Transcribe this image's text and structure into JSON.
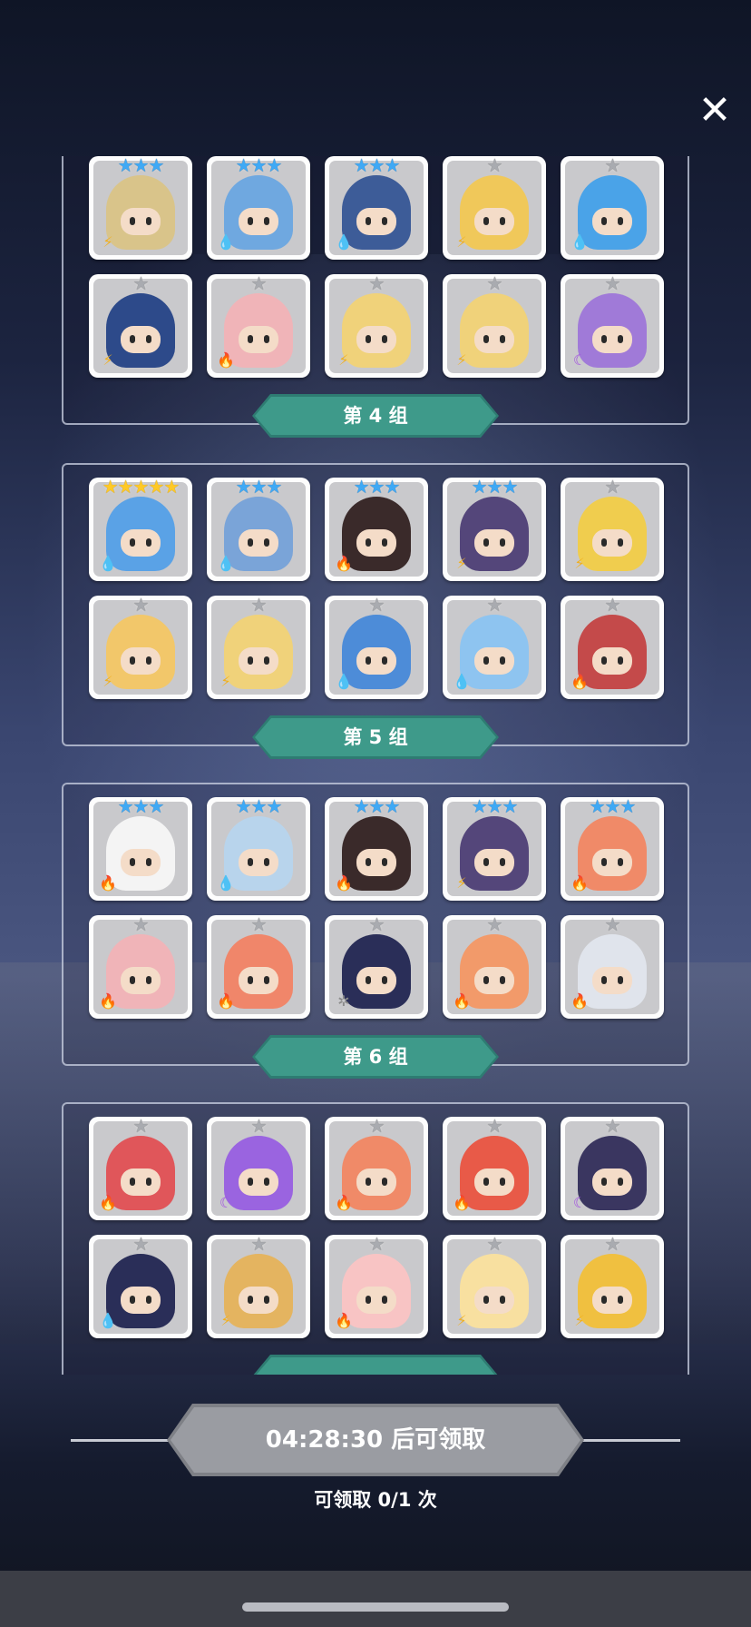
{
  "close_icon": "close-icon",
  "groups": [
    {
      "label": "第 4 组",
      "cards": [
        {
          "stars": 3,
          "star_color": "blue",
          "element": "thunder",
          "color": "#d9c48a"
        },
        {
          "stars": 3,
          "star_color": "blue",
          "element": "water",
          "color": "#6fa8e0"
        },
        {
          "stars": 3,
          "star_color": "blue",
          "element": "water",
          "color": "#3d5c98"
        },
        {
          "stars": 1,
          "star_color": "grey",
          "element": "thunder",
          "color": "#f0c85a"
        },
        {
          "stars": 1,
          "star_color": "grey",
          "element": "water",
          "color": "#4aa3e8"
        },
        {
          "stars": 1,
          "star_color": "grey",
          "element": "thunder",
          "color": "#2d4a8a"
        },
        {
          "stars": 1,
          "star_color": "grey",
          "element": "fire",
          "color": "#f0b4b8"
        },
        {
          "stars": 1,
          "star_color": "grey",
          "element": "thunder",
          "color": "#f0d27a"
        },
        {
          "stars": 1,
          "star_color": "grey",
          "element": "thunder",
          "color": "#f0d27a"
        },
        {
          "stars": 1,
          "star_color": "grey",
          "element": "dark",
          "color": "#a07ad8"
        }
      ]
    },
    {
      "label": "第 5 组",
      "cards": [
        {
          "stars": 5,
          "star_color": "gold",
          "element": "water",
          "color": "#5aa2e6"
        },
        {
          "stars": 3,
          "star_color": "blue",
          "element": "water",
          "color": "#7aa4d8"
        },
        {
          "stars": 3,
          "star_color": "blue",
          "element": "fire",
          "color": "#3a2a2a"
        },
        {
          "stars": 3,
          "star_color": "blue",
          "element": "thunder",
          "color": "#54467a"
        },
        {
          "stars": 1,
          "star_color": "grey",
          "element": "thunder",
          "color": "#f0cd4e"
        },
        {
          "stars": 1,
          "star_color": "grey",
          "element": "thunder",
          "color": "#f2c76a"
        },
        {
          "stars": 1,
          "star_color": "grey",
          "element": "thunder",
          "color": "#f0d27a"
        },
        {
          "stars": 1,
          "star_color": "grey",
          "element": "water",
          "color": "#4d8cd8"
        },
        {
          "stars": 1,
          "star_color": "grey",
          "element": "water",
          "color": "#8ec4f0"
        },
        {
          "stars": 1,
          "star_color": "grey",
          "element": "fire",
          "color": "#c44a4a"
        }
      ]
    },
    {
      "label": "第 6 组",
      "cards": [
        {
          "stars": 3,
          "star_color": "blue",
          "element": "fire",
          "color": "#f4f4f4"
        },
        {
          "stars": 3,
          "star_color": "blue",
          "element": "water",
          "color": "#b8d4ec"
        },
        {
          "stars": 3,
          "star_color": "blue",
          "element": "fire",
          "color": "#3a2a2a"
        },
        {
          "stars": 3,
          "star_color": "blue",
          "element": "thunder",
          "color": "#54467a"
        },
        {
          "stars": 3,
          "star_color": "blue",
          "element": "fire",
          "color": "#f08a68"
        },
        {
          "stars": 1,
          "star_color": "grey",
          "element": "fire",
          "color": "#f0b4b8"
        },
        {
          "stars": 1,
          "star_color": "grey",
          "element": "fire",
          "color": "#f0866a"
        },
        {
          "stars": 1,
          "star_color": "grey",
          "element": "light",
          "color": "#2a2e58"
        },
        {
          "stars": 1,
          "star_color": "grey",
          "element": "fire",
          "color": "#f29a6a"
        },
        {
          "stars": 1,
          "star_color": "grey",
          "element": "fire",
          "color": "#e0e4ec"
        }
      ]
    },
    {
      "label": "",
      "cards": [
        {
          "stars": 1,
          "star_color": "grey",
          "element": "fire",
          "color": "#e0565a"
        },
        {
          "stars": 1,
          "star_color": "grey",
          "element": "dark",
          "color": "#9a64e0"
        },
        {
          "stars": 1,
          "star_color": "grey",
          "element": "fire",
          "color": "#f08a68"
        },
        {
          "stars": 1,
          "star_color": "grey",
          "element": "fire",
          "color": "#e85a48"
        },
        {
          "stars": 1,
          "star_color": "grey",
          "element": "dark",
          "color": "#3a3660"
        },
        {
          "stars": 1,
          "star_color": "grey",
          "element": "water",
          "color": "#2a2e58"
        },
        {
          "stars": 1,
          "star_color": "grey",
          "element": "thunder",
          "color": "#e4b460"
        },
        {
          "stars": 1,
          "star_color": "grey",
          "element": "fire",
          "color": "#f8c4c4"
        },
        {
          "stars": 1,
          "star_color": "grey",
          "element": "thunder",
          "color": "#f8e0a0"
        },
        {
          "stars": 1,
          "star_color": "grey",
          "element": "thunder",
          "color": "#f0c040"
        }
      ]
    }
  ],
  "element_icons": {
    "water": "💧",
    "fire": "🔥",
    "thunder": "⚡",
    "dark": "☾",
    "light": "✲"
  },
  "element_colors": {
    "water": "#2f8fe8",
    "fire": "#e8452a",
    "thunder": "#f0b020",
    "dark": "#a04ee0",
    "light": "#8a8a8a"
  },
  "timer": {
    "text": "04:28:30 后可领取"
  },
  "claim": {
    "text": "可领取 0/1 次"
  }
}
